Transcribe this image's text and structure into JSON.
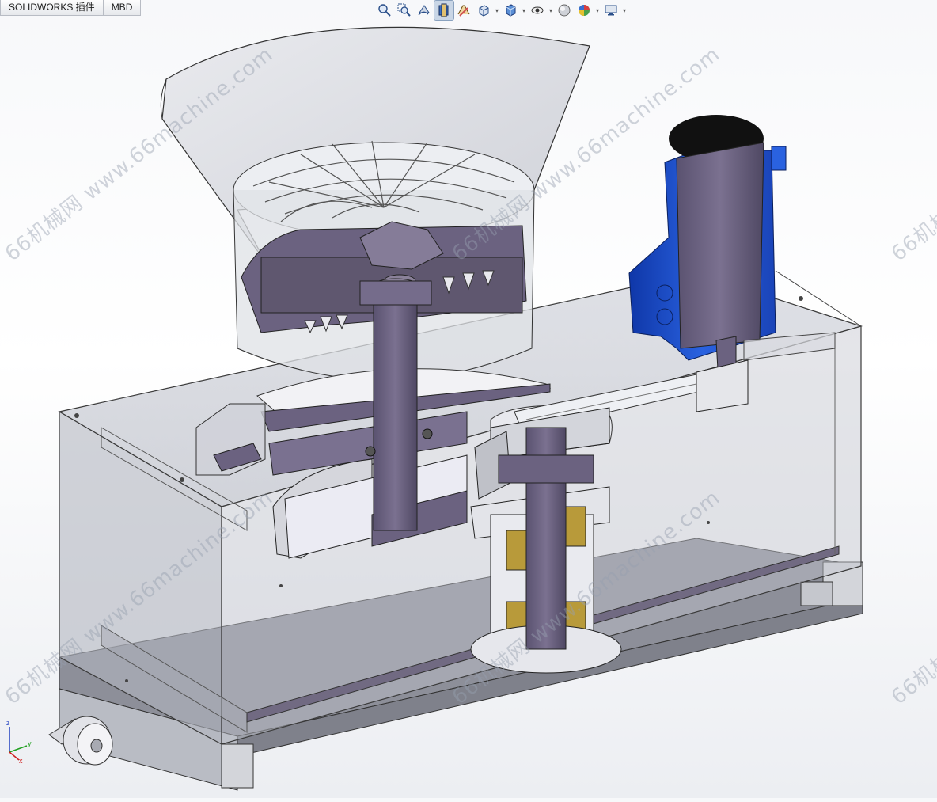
{
  "tabs": [
    {
      "label": "SOLIDWORKS 插件"
    },
    {
      "label": "MBD"
    }
  ],
  "toolbar": {
    "items": [
      {
        "name": "zoom-to-fit-icon"
      },
      {
        "name": "zoom-to-area-icon"
      },
      {
        "name": "previous-view-icon"
      },
      {
        "name": "section-view-icon"
      },
      {
        "name": "dynamic-annotation-icon"
      },
      {
        "name": "view-orientation-icon"
      },
      {
        "name": "display-style-icon"
      },
      {
        "name": "hide-show-items-icon"
      },
      {
        "name": "edit-appearance-icon"
      },
      {
        "name": "apply-scene-icon"
      },
      {
        "name": "view-settings-icon"
      }
    ]
  },
  "watermark": {
    "text": "66机械网 www.66machine.com"
  },
  "triad": {
    "x": "x",
    "y": "y",
    "z": "z"
  },
  "colors": {
    "frame": "#5e5670",
    "motor_blue": "#1f4fc7",
    "part_purple": "#6e6484",
    "glass": "#b9bcc6"
  }
}
